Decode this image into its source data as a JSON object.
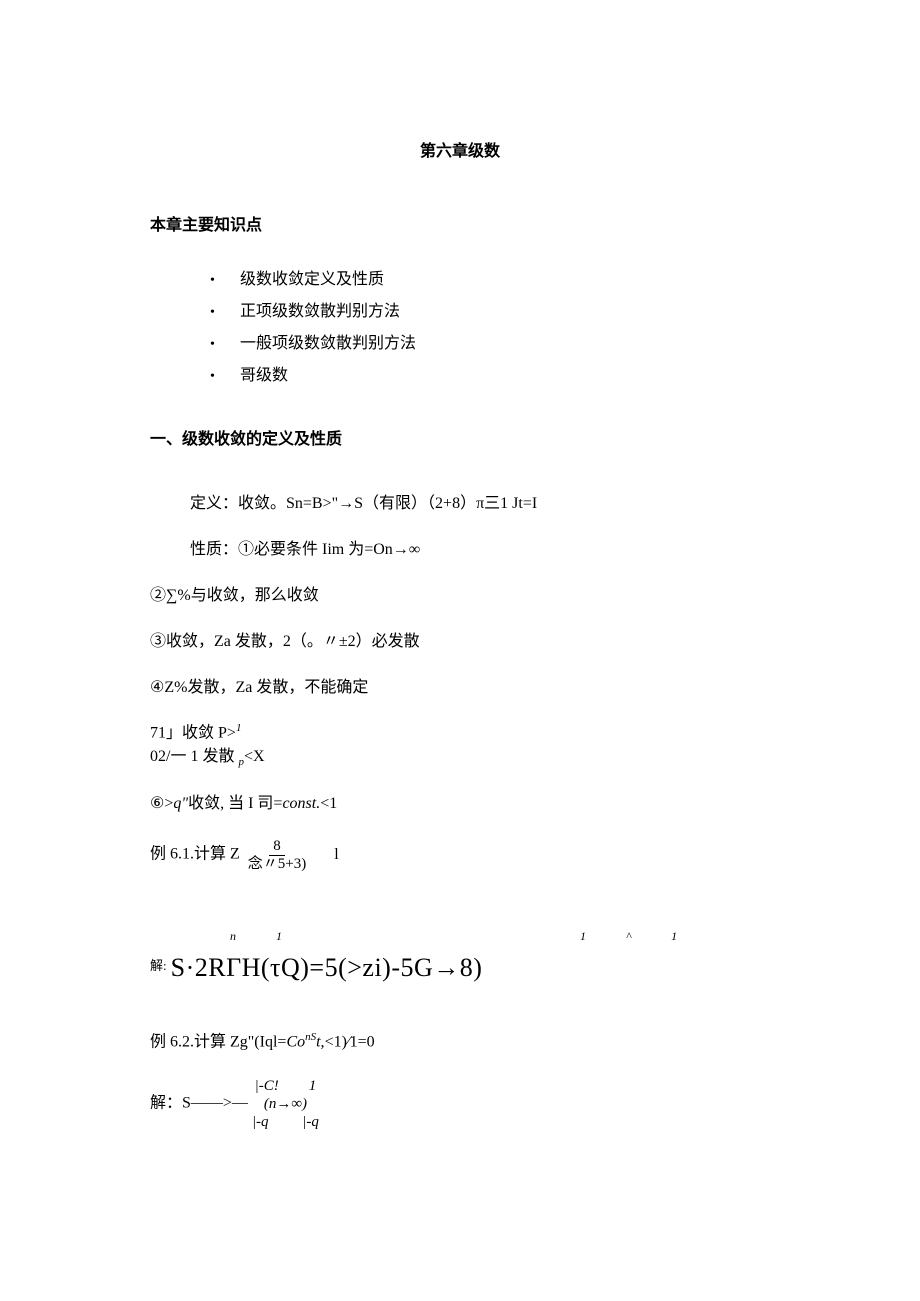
{
  "title": "第六章级数",
  "section1_title": "本章主要知识点",
  "bullets": [
    "级数收敛定义及性质",
    "正项级数敛散判别方法",
    "一般项级数敛散判别方法",
    "哥级数"
  ],
  "heading2": "一、级数收敛的定义及性质",
  "def_line": "定义：收敛。Sn=B>\"→S（有限）（2+8）π三1        Jt=I",
  "prop1": "性质：①必要条件 Iim 为=On→∞",
  "prop2": "②∑%与收敛，那么收敛",
  "prop3": "③收敛，Za 发散，2（。〃±2）必发散",
  "prop4": "④Z%发散，Za 发散，不能确定",
  "prop5a": "71」收敛 P>",
  "prop5a_sup": "1",
  "prop5b_prefix": "02/一 1 发散 ",
  "prop5b_sub": "p",
  "prop5b_suffix": "<X",
  "prop6_prefix": "⑥>",
  "prop6_q": "q\"",
  "prop6_mid": "收敛, 当 I 司=",
  "prop6_const": "const.",
  "prop6_suffix": "<1",
  "ex61_prefix": "例 6.1.计算 Z",
  "ex61_frac_top": "8",
  "ex61_frac_bot": "念〃5+3)",
  "ex61_trail": "l",
  "big_sup_row": "n1      1^1     1    I     I      I",
  "big_eq_prefix": "解:",
  "big_eq": "S·2RΓH(τQ)=5(>zi)-5G→8)",
  "ex62": "例 6.2.计算 Zg\"(Iql=",
  "ex62_const": "Co",
  "ex62_sup": "nS",
  "ex62_t": "t,",
  "ex62_suffix": "<1)∕1=0",
  "sol2_prefix": "解：S——>—",
  "sol2_stack_top": "|-C!        1",
  "sol2_stack_mid": "(n→∞)",
  "sol2_stack_bot": "|-q         |-q"
}
